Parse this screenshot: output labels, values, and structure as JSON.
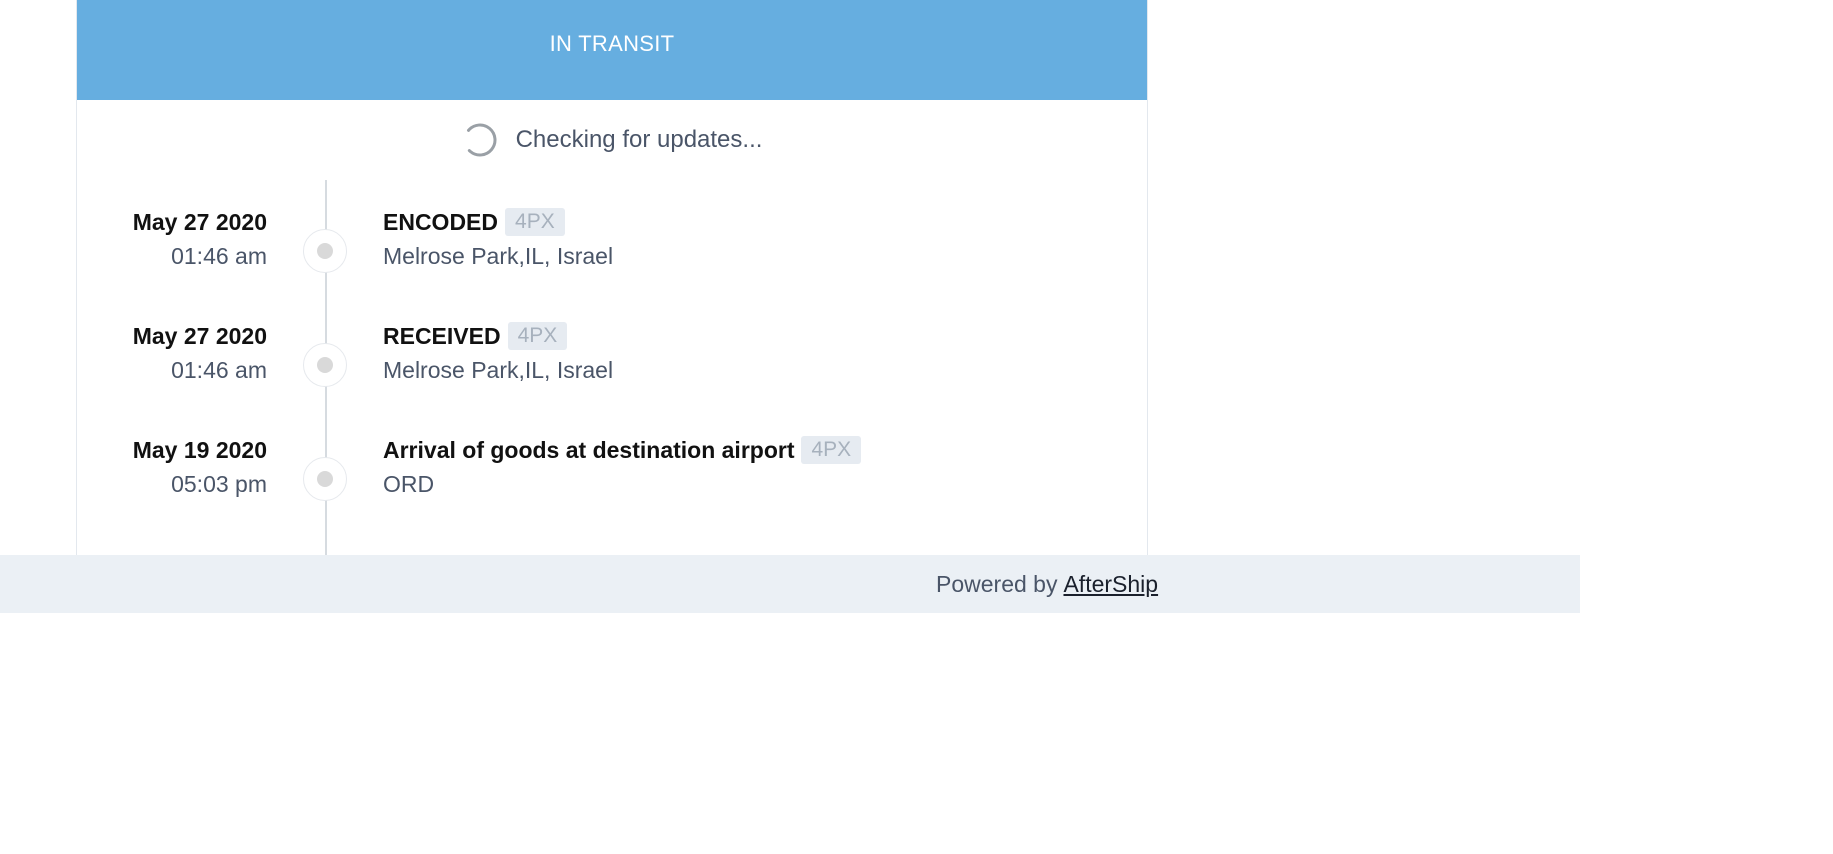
{
  "status": {
    "label": "IN TRANSIT",
    "color": "#66aee0"
  },
  "updates": {
    "text": "Checking for updates...",
    "icon": "spinner-icon"
  },
  "events": [
    {
      "date": "May 27 2020",
      "time": "01:46 am",
      "title": "ENCODED",
      "badge": "4PX",
      "location": "Melrose Park,IL, Israel"
    },
    {
      "date": "May 27 2020",
      "time": "01:46 am",
      "title": "RECEIVED",
      "badge": "4PX",
      "location": "Melrose Park,IL, Israel"
    },
    {
      "date": "May 19 2020",
      "time": "05:03 pm",
      "title": "Arrival of goods at destination airport",
      "badge": "4PX",
      "location": "ORD"
    }
  ],
  "footer": {
    "powered_by": "Powered by",
    "brand_link": "AfterShip"
  }
}
